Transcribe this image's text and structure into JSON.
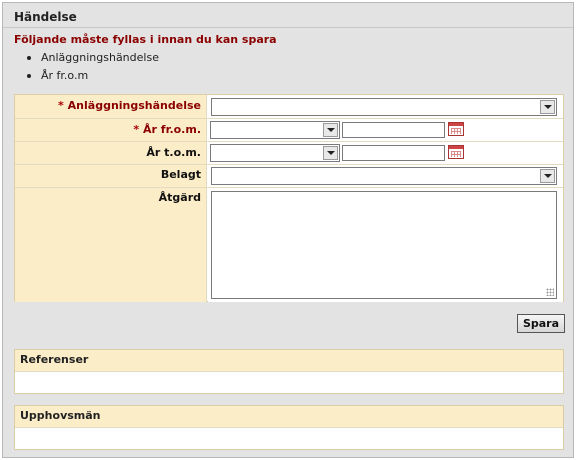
{
  "panel": {
    "title": "Händelse"
  },
  "validation": {
    "heading": "Följande måste fyllas i innan du kan spara",
    "items": [
      "Anläggningshändelse",
      "År fr.o.m"
    ]
  },
  "form": {
    "fields": {
      "anlaggningshandelse": {
        "label": "Anläggningshändelse",
        "required_marker": "*"
      },
      "ar_from": {
        "label": "År fr.o.m.",
        "required_marker": "*"
      },
      "ar_tom": {
        "label": "År t.o.m."
      },
      "belagt": {
        "label": "Belagt"
      },
      "atgard": {
        "label": "Åtgärd"
      }
    }
  },
  "actions": {
    "save_label": "Spara"
  },
  "sections": {
    "referenser": {
      "title": "Referenser"
    },
    "upphovsman": {
      "title": "Upphovsmän"
    }
  },
  "icons": {
    "select_arrow": "chevron-down-icon",
    "calendar": "calendar-icon",
    "resize": "resize-grip-icon"
  }
}
